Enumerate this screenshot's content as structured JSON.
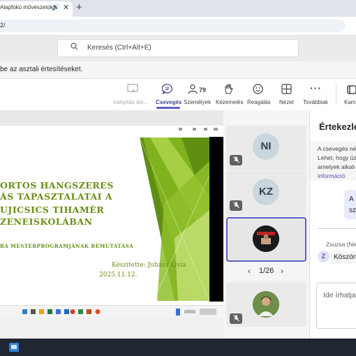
{
  "browser": {
    "tab_title": "Alapfokú művészetokt",
    "new_tab": "+",
    "close": "✕",
    "address": "2/"
  },
  "teams": {
    "search_placeholder": "Keresés (Ctrl+Alt+E)",
    "notification": "be az asztali értesítéseket.",
    "toolbar": {
      "share_label": "Irányítás átv...",
      "chat_label": "Csevegés",
      "people_label": "Személyek",
      "people_count": "79",
      "raise_label": "Kézemelés",
      "react_label": "Reagálás",
      "view_label": "Nézet",
      "more_label": "Továbbiak",
      "camera_label": "Kam"
    }
  },
  "slide": {
    "title_line1": "ORTOS HANGSZERES",
    "title_line2": "ÁS TAPASZTALATAI A",
    "title_line3": "UJICSICS TIHAMÉR",
    "title_line4": "ZENEISKOLÁBAN",
    "subtitle": "RA MESTERPROGRAMJÁNAK BEMUTATÁSA",
    "author": "Készítette: Juhász Lívia",
    "date": "2025.11.12."
  },
  "participants": {
    "tile1_initials": "NI",
    "tile2_initials": "KZ",
    "pager": "1/26"
  },
  "chat": {
    "title": "Értekezle",
    "info_line1": "A csevegés né",
    "info_line2": "Lehet, hogy üz",
    "info_line3": "amelyek alkalı",
    "info_link": "információ",
    "bubble_line1": "A",
    "bubble_line2": "sz",
    "sender": "Zsuzsa (Ner",
    "sender_initial": "Z",
    "message": "Köszön",
    "compose_placeholder": "Ide írhatja"
  },
  "colors": {
    "accent": "#5b5fc7",
    "slide_green": "#6a8e15",
    "taskbar": "#1f2733"
  },
  "icons": {
    "search": "search-icon",
    "share": "share-control-icon",
    "chat": "chat-icon",
    "people": "people-icon",
    "raise": "raise-hand-icon",
    "react": "emoji-icon",
    "view": "grid-view-icon",
    "more": "more-icon",
    "camera": "camera-icon",
    "mic_muted": "mic-muted-icon"
  }
}
